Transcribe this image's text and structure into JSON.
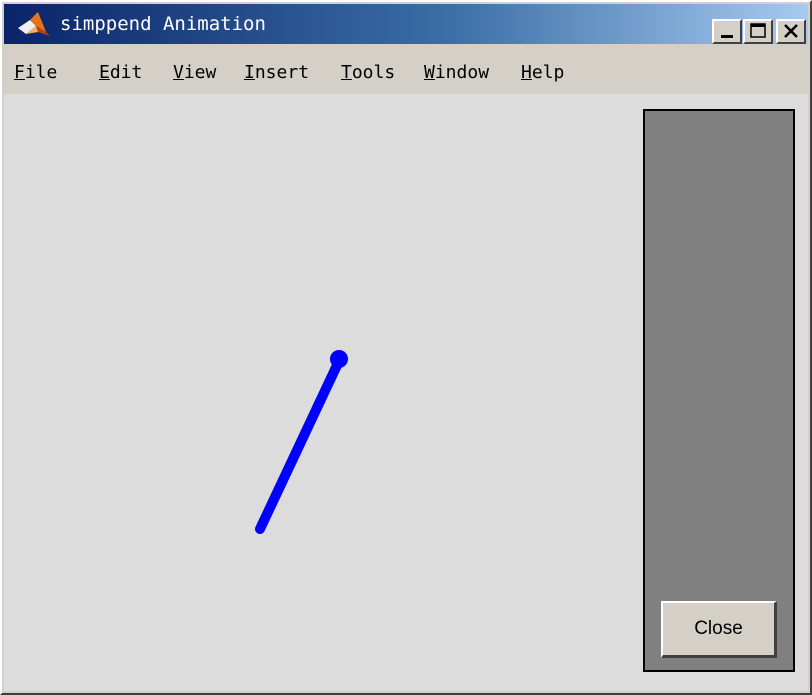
{
  "window": {
    "title": "simppend Animation",
    "controls": [
      "minimize",
      "maximize",
      "close"
    ]
  },
  "menubar": {
    "items": [
      {
        "mnemonic": "F",
        "rest": "ile"
      },
      {
        "mnemonic": "E",
        "rest": "dit"
      },
      {
        "mnemonic": "V",
        "rest": "iew"
      },
      {
        "mnemonic": "I",
        "rest": "nsert"
      },
      {
        "mnemonic": "T",
        "rest": "ools"
      },
      {
        "mnemonic": "W",
        "rest": "indow"
      },
      {
        "mnemonic": "H",
        "rest": "elp"
      }
    ]
  },
  "panel": {
    "close_label": "Close"
  },
  "colors": {
    "pendulum": "#0000ff",
    "figure_background": "#dcdcdc",
    "panel_background": "#808080"
  },
  "icons": [
    "matlab-logo-icon",
    "minimize-icon",
    "maximize-icon",
    "close-icon"
  ]
}
